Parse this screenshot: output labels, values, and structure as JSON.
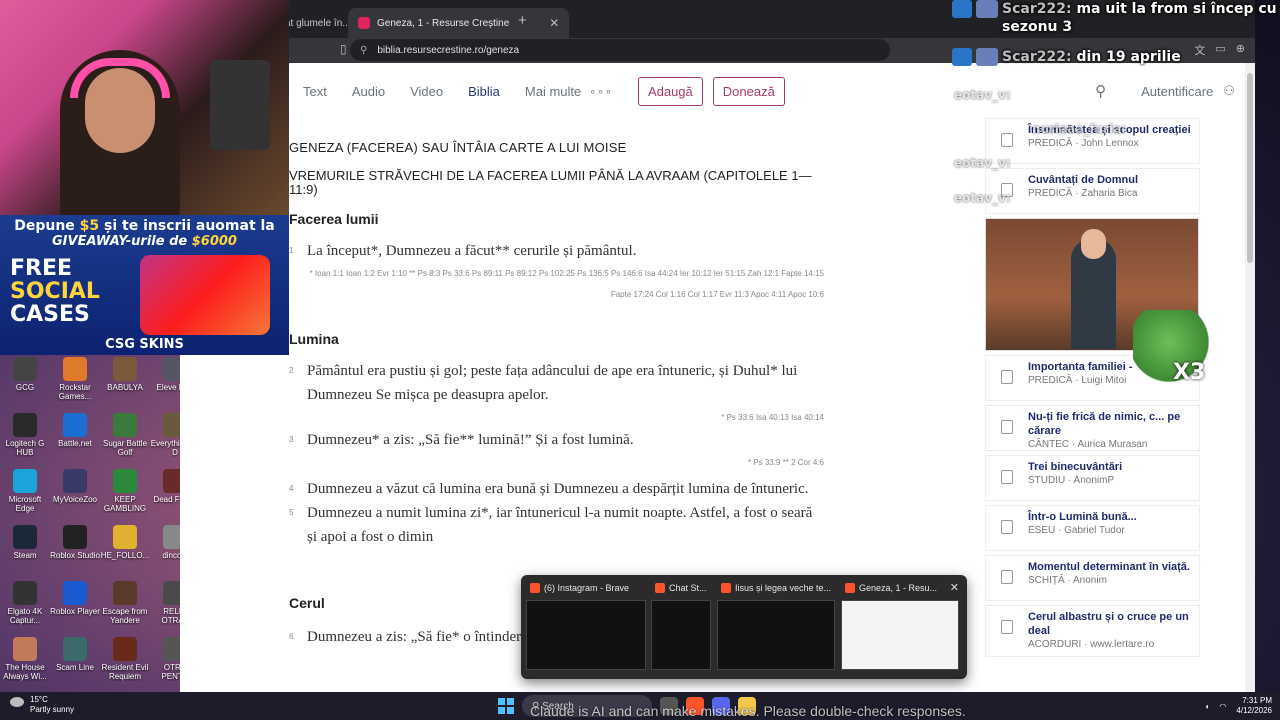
{
  "browser": {
    "tabs": [
      {
        "label": "at glumele în..."
      },
      {
        "label": "Geneza, 1 - Resurse Creștine"
      }
    ],
    "url": "biblia.resursecrestine.ro/geneza"
  },
  "site_nav": {
    "links": [
      "Text",
      "Audio",
      "Video",
      "Biblia",
      "Mai multe"
    ],
    "buttons": [
      "Adaugă",
      "Donează"
    ],
    "login": "Autentificare"
  },
  "chapter": {
    "book_title": "GENEZA (FACEREA) SAU ÎNTÂIA CARTE A LUI MOISE",
    "section_title": "VREMURILE STRĂVECHI DE LA FACEREA LUMII PÂNĂ LA AVRAAM (CAPITOLELE 1—11:9)",
    "sections": [
      {
        "heading": "Facerea lumii",
        "verses": [
          {
            "num": "1",
            "text": "La început*, Dumnezeu a făcut** cerurile și pământul.",
            "refs": "* Ioan 1:1 Ioan 1:2 Evr 1:10 ** Ps 8:3 Ps 33:6 Ps 89:11 Ps 89:12 Ps 102:25 Ps 136:5 Ps 146:6 Isa 44:24 Ier 10:12 Ier 51:15 Zah 12:1 Fapte 14:15 Fapte 17:24 Col 1:16 Col 1:17 Evr 11:3 Apoc 4:11 Apoc 10:6"
          }
        ]
      },
      {
        "heading": "Lumina",
        "verses": [
          {
            "num": "2",
            "text": "Pământul era pustiu și gol; peste fața adâncului de ape era întuneric, și Duhul* lui Dumnezeu Se mișca pe deasupra apelor.",
            "refs": "* Ps 33:6 Isa 40:13 Isa 40:14"
          },
          {
            "num": "3",
            "text": "Dumnezeu* a zis: „Să fie** lumină!” Și a fost lumină.",
            "refs": "* Ps 33:9 ** 2 Cor 4:6"
          },
          {
            "num": "4",
            "text": "Dumnezeu a văzut că lumina era bună și Dumnezeu a despărțit lumina de întuneric.",
            "refs": ""
          },
          {
            "num": "5",
            "text": "Dumnezeu a numit lumina zi*, iar întunericul l-a numit noapte. Astfel, a fost o seară și apoi a fost o dimin",
            "refs": ""
          }
        ]
      },
      {
        "heading": "Cerul",
        "verses": [
          {
            "num": "6",
            "text": "Dumnezeu a zis: „Să fie* o întindere între ape și ea să despartă apele de",
            "refs": ""
          }
        ]
      }
    ]
  },
  "sidebar": {
    "items": [
      {
        "title": "Însemnătatea și scopul creației",
        "meta": "PREDICĂ · John Lennox"
      },
      {
        "title": "Cuvântați de Domnul",
        "meta": "PREDICĂ · Zaharia Bica"
      },
      {
        "title": "Importanta familiei -",
        "meta": "PREDICĂ · Luigi Mitoi"
      },
      {
        "title": "Nu-ți fie frică de nimic, c... pe cărare",
        "meta": "CÂNTEC · Aurica Murasan"
      },
      {
        "title": "Trei binecuvântări",
        "meta": "STUDIU · AnonimP"
      },
      {
        "title": "Într-o Lumină bună...",
        "meta": "ESEU · Gabriel Tudor"
      },
      {
        "title": "Momentul determinant în viață.",
        "meta": "SCHIȚĂ · Anonim"
      },
      {
        "title": "Cerul albastru și o cruce pe un deal",
        "meta": "ACORDURI · www.lertare.ro"
      }
    ]
  },
  "chat": {
    "messages": [
      {
        "user": "Scar222:",
        "text": "ma uit la from si încep cu sezonu 3"
      },
      {
        "user": "Scar222:",
        "text": "din 19 aprilie"
      }
    ],
    "small_users": [
      "eotav_v:",
      "nuriaaa_furia:",
      "eotav_v:",
      "eotav_v:"
    ],
    "emote_label": "X3"
  },
  "promo": {
    "line1_pre": "Depune ",
    "line1_amount": "$5",
    "line1_post": " și te inscrii auomat la",
    "line2_pre": "GIVEAWAY-urile de ",
    "line2_amount": "$6000",
    "free_1": "FREE",
    "free_2": "SOCIAL",
    "free_3": "CASES",
    "brand": "CSG SKINS"
  },
  "desktop_icons": [
    "GCG",
    "Rockstar Games...",
    "BABULYA",
    "Eleve Den",
    "Logitech G HUB",
    "Battle.net",
    "Sugar Battle Golf",
    "Everythi Crab D",
    "Microsoft Edge",
    "MyVoiceZoo",
    "KEEP GAMBLING",
    "Dead F Dan",
    "Steam",
    "Roblox Studio",
    "HE_FOLLO...",
    "dincolo",
    "Elgato 4K Captur...",
    "Roblox Player",
    "Escape from Yandere",
    "RELIC OTRAV",
    "The House Always Wi...",
    "Scam Line",
    "Resident Evil Requiem",
    "OTRA PENTR"
  ],
  "thumbnails": [
    {
      "title": "(6) Instagram - Brave"
    },
    {
      "title": "Chat St..."
    },
    {
      "title": "Iisus și legea veche te..."
    },
    {
      "title": "Geneza, 1 - Resu..."
    }
  ],
  "taskbar": {
    "weather_temp": "15°C",
    "weather_desc": "Partly sunny",
    "search": "Search",
    "time": "7:31 PM",
    "date": "4/12/2026"
  },
  "overlay_note": "Claude is AI and can make mistakes. Please double-check responses.",
  "colors": {
    "accent": "#a53a70",
    "link_title": "#1f2b6d",
    "nav_active": "#2b3a74"
  }
}
